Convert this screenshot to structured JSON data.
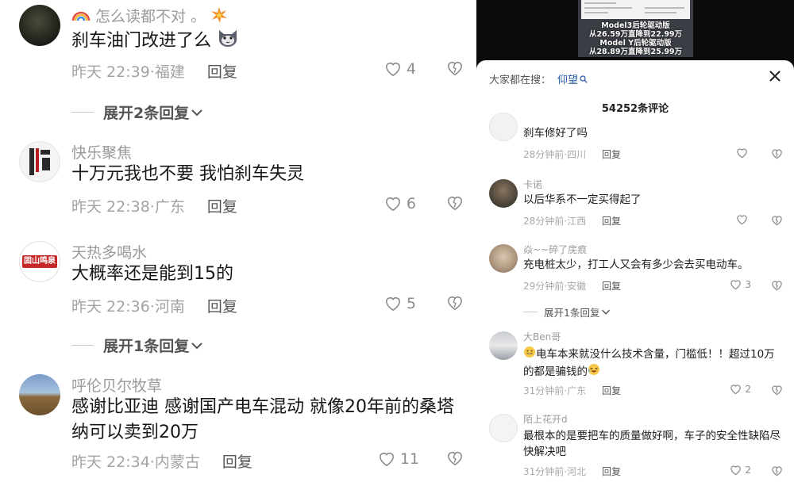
{
  "left_comments": [
    {
      "username": "怎么读都不对 。",
      "text": "刹车油门改进了么",
      "time": "昨天 22:39",
      "location": "福建",
      "reply": "回复",
      "likes": "4"
    },
    {
      "username": "快乐聚焦",
      "text": "十万元我也不要   我怕刹车失灵",
      "time": "昨天 22:38",
      "location": "广东",
      "reply": "回复",
      "likes": "6"
    },
    {
      "username": "天热多喝水",
      "text": "大概率还是能到15的",
      "time": "昨天 22:36",
      "location": "河南",
      "reply": "回复",
      "likes": "5",
      "avatar_text": "固山鸣泉"
    },
    {
      "username": "呼伦贝尔牧草",
      "text": "感谢比亚迪  感谢国产电车混动      就像20年前的桑塔纳可以卖到20万",
      "time": "昨天 22:34",
      "location": "内蒙古",
      "reply": "回复",
      "likes": "11"
    }
  ],
  "left_expand": [
    "展开2条回复",
    "展开1条回复"
  ],
  "video": {
    "overlay": [
      "Model3后轮驱动版",
      "从26.59万直降到22.99万",
      "Model Y后轮驱动版",
      "从28.89万直降到25.99万"
    ]
  },
  "sheet": {
    "search_label": "大家都在搜：",
    "search_term": "仰望",
    "comment_count": "54252条评论",
    "expand": "展开1条回复",
    "comments": [
      {
        "username": "",
        "text": "刹车修好了吗",
        "time": "28分钟前",
        "location": "四川",
        "reply": "回复",
        "likes": ""
      },
      {
        "username": "卡诺",
        "text": "以后华系不一定买得起了",
        "time": "28分钟前",
        "location": "江西",
        "reply": "回复",
        "likes": ""
      },
      {
        "username": "焱~~碎了庑痕",
        "text": "充电桩太少，打工人又会有多少会去买电动车。",
        "time": "29分钟前",
        "location": "安徽",
        "reply": "回复",
        "likes": "3"
      },
      {
        "username": "大Ben哥",
        "text": "电车本来就没什么技术含量，门槛低！！超过10万的都是骗钱的",
        "time": "31分钟前",
        "location": "广东",
        "reply": "回复",
        "likes": "2"
      },
      {
        "username": "陌上花开d",
        "text": "最根本的是要把车的质量做好啊，车子的安全性缺陷尽快解决吧",
        "time": "31分钟前",
        "location": "河北",
        "reply": "回复",
        "likes": "2"
      }
    ]
  },
  "icons": [
    "heart-icon",
    "broken-heart-icon",
    "chevron-down-icon",
    "search-icon",
    "close-icon",
    "rainbow-icon",
    "explosion-icon",
    "cat-icon",
    "grin-emoji-icon",
    "laugh-emoji-icon"
  ]
}
